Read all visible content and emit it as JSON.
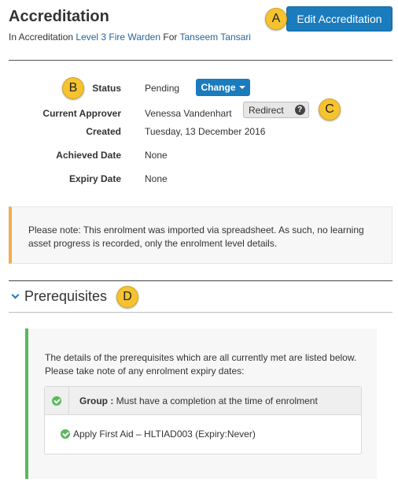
{
  "header": {
    "title": "Accreditation",
    "subtitle_prefix": "In Accreditation",
    "accreditation_link": "Level 3 Fire Warden",
    "subtitle_for": "For",
    "person_link": "Tanseem Tansari",
    "edit_button": "Edit Accreditation"
  },
  "markers": {
    "a": "A",
    "b": "B",
    "c": "C",
    "d": "D"
  },
  "details": {
    "status_label": "Status",
    "status_value": "Pending",
    "change_button": "Change",
    "approver_label": "Current Approver",
    "approver_value": "Venessa Vandenhart",
    "redirect_button": "Redirect",
    "help_icon_glyph": "?",
    "created_label": "Created",
    "created_value": "Tuesday, 13 December 2016",
    "achieved_label": "Achieved Date",
    "achieved_value": "None",
    "expiry_label": "Expiry Date",
    "expiry_value": "None"
  },
  "note": {
    "text": "Please note: This enrolment was imported via spreadsheet. As such, no learning asset progress is recorded, only the enrolment level details."
  },
  "prerequisites": {
    "heading": "Prerequisites",
    "intro": "The details of the prerequisites which are all currently met are listed below. Please take note of any enrolment expiry dates:",
    "group_label": "Group :",
    "group_text": "Must have a completion at the time of enrolment",
    "item": "Apply First Aid – HLTIAD003 (Expiry:Never)"
  },
  "colors": {
    "primary": "#1a7bbd",
    "marker": "#f5c330",
    "warning_border": "#f0ad4e",
    "success": "#5cb85c"
  },
  "icons": [
    "chevron-down-icon",
    "help-icon",
    "check-circle-icon",
    "caret-down-icon"
  ]
}
